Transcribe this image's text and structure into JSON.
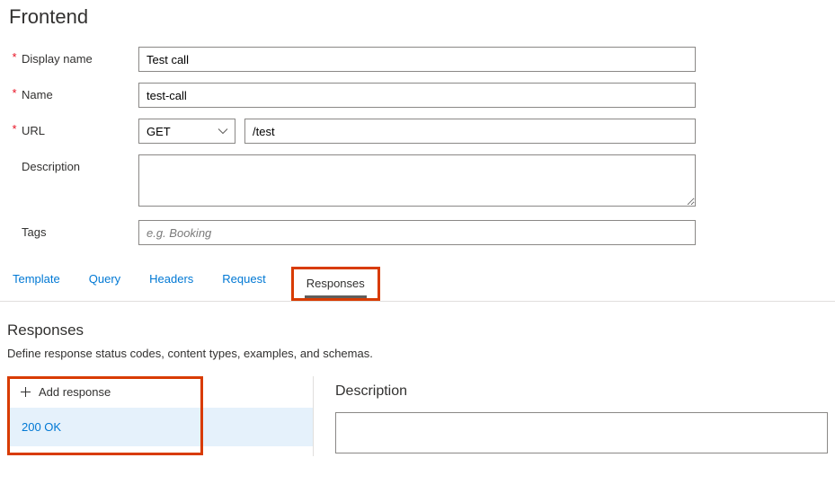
{
  "page_title": "Frontend",
  "labels": {
    "display_name": "Display name",
    "name": "Name",
    "url": "URL",
    "description": "Description",
    "tags": "Tags"
  },
  "fields": {
    "display_name": "Test call",
    "name": "test-call",
    "http_method": "GET",
    "url_path": "/test",
    "description": "",
    "tags_placeholder": "e.g. Booking"
  },
  "tabs": {
    "template": "Template",
    "query": "Query",
    "headers": "Headers",
    "request": "Request",
    "responses": "Responses"
  },
  "responses": {
    "heading": "Responses",
    "subtext": "Define response status codes, content types, examples, and schemas.",
    "add_label": "Add response",
    "items": [
      "200 OK"
    ]
  },
  "detail": {
    "description_title": "Description",
    "description_value": ""
  }
}
